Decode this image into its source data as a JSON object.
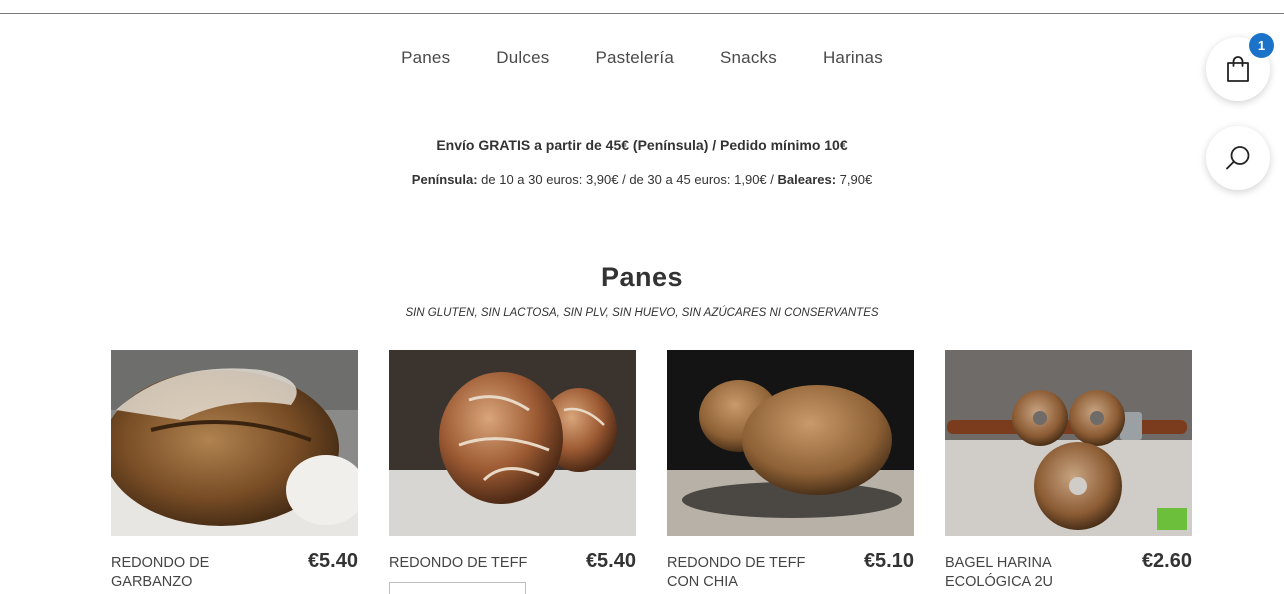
{
  "nav": {
    "items": [
      "Panes",
      "Dulces",
      "Pastelería",
      "Snacks",
      "Harinas"
    ]
  },
  "cart": {
    "count": "1",
    "icon": "shopping-bag-icon",
    "badge_color": "#1a73c9"
  },
  "search": {
    "icon": "search-icon"
  },
  "shipping": {
    "line1": "Envío GRATIS a partir de 45€ (Península) / Pedido mínimo 10€",
    "line2_label1": "Península:",
    "line2_text1": " de 10 a 30 euros: 3,90€ / de 30 a 45 euros: 1,90€ / ",
    "line2_label2": "Baleares:",
    "line2_text2": " 7,90€"
  },
  "section": {
    "title": "Panes",
    "subtitle": "SIN GLUTEN, SIN LACTOSA, SIN PLV, SIN HUEVO, SIN AZÚCARES NI CONSERVANTES"
  },
  "products": [
    {
      "name": "REDONDO DE GARBANZO",
      "price": "€5.40"
    },
    {
      "name": "REDONDO DE TEFF",
      "price": "€5.40"
    },
    {
      "name": "REDONDO DE TEFF CON CHIA",
      "price": "€5.10"
    },
    {
      "name": "BAGEL HARINA ECOLÓGICA 2U",
      "price": "€2.60"
    }
  ]
}
